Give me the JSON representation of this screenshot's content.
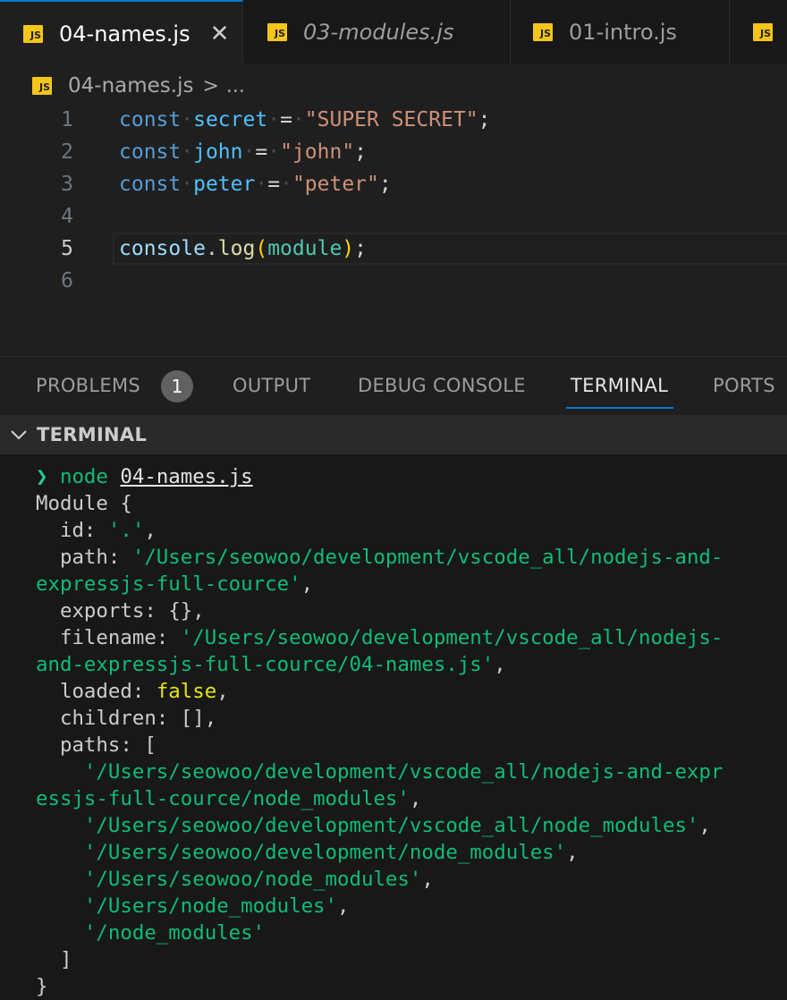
{
  "tabs": [
    {
      "label": "04-names.js",
      "badge": "JS",
      "active": true
    },
    {
      "label": "03-modules.js",
      "badge": "JS",
      "active": false
    },
    {
      "label": "01-intro.js",
      "badge": "JS",
      "active": false
    },
    {
      "label": "",
      "badge": "JS",
      "active": false
    }
  ],
  "breadcrumb": {
    "file": "04-names.js",
    "separator": ">",
    "more": "..."
  },
  "editor": {
    "line_numbers": [
      "1",
      "2",
      "3",
      "4",
      "5",
      "6"
    ],
    "current_line": "5",
    "lines": {
      "l1": {
        "kw": "const",
        "name": "secret",
        "op": "=",
        "value": "\"SUPER SECRET\"",
        "end": ";"
      },
      "l2": {
        "kw": "const",
        "name": "john",
        "op": "=",
        "value": "\"john\"",
        "end": ";"
      },
      "l3": {
        "kw": "const",
        "name": "peter",
        "op": "=",
        "value": "\"peter\"",
        "end": ";"
      },
      "l5": {
        "obj": "console",
        "dot": ".",
        "fn": "log",
        "open": "(",
        "arg": "module",
        "close": ")",
        "end": ";"
      }
    }
  },
  "panel": {
    "tabs": [
      "PROBLEMS",
      "OUTPUT",
      "DEBUG CONSOLE",
      "TERMINAL",
      "PORTS"
    ],
    "problems_count": "1",
    "active_tab": "TERMINAL"
  },
  "terminal": {
    "section_title": "TERMINAL",
    "prompt_symbol": "❯",
    "command": "node",
    "command_arg": "04-names.js",
    "output": [
      {
        "plain": "Module {"
      },
      {
        "key": "  id: ",
        "str": "'.'",
        "tail": ","
      },
      {
        "key": "  path: ",
        "str": "'/Users/seowoo/development/vscode_all/nodejs-and-"
      },
      {
        "str": "expressjs-full-cource'",
        "tail": ","
      },
      {
        "plain": "  exports: {},"
      },
      {
        "key": "  filename: ",
        "str": "'/Users/seowoo/development/vscode_all/nodejs-"
      },
      {
        "str": "and-expressjs-full-cource/04-names.js'",
        "tail": ","
      },
      {
        "key": "  loaded: ",
        "bool": "false",
        "tail": ","
      },
      {
        "plain": "  children: [],"
      },
      {
        "plain": "  paths: ["
      },
      {
        "key": "    ",
        "str": "'/Users/seowoo/development/vscode_all/nodejs-and-expr"
      },
      {
        "str": "essjs-full-cource/node_modules'",
        "tail": ","
      },
      {
        "key": "    ",
        "str": "'/Users/seowoo/development/vscode_all/node_modules'",
        "tail": ","
      },
      {
        "key": "    ",
        "str": "'/Users/seowoo/development/node_modules'",
        "tail": ","
      },
      {
        "key": "    ",
        "str": "'/Users/seowoo/node_modules'",
        "tail": ","
      },
      {
        "key": "    ",
        "str": "'/Users/node_modules'",
        "tail": ","
      },
      {
        "key": "    ",
        "str": "'/node_modules'"
      },
      {
        "plain": "  ]"
      },
      {
        "plain": "}"
      }
    ]
  },
  "colors": {
    "accent": "#0078d4",
    "js_badge": "#f5c518",
    "keyword": "#569cd6",
    "string": "#ce9178",
    "terminal_string": "#0dbc79",
    "terminal_boolean": "#e5e510"
  }
}
